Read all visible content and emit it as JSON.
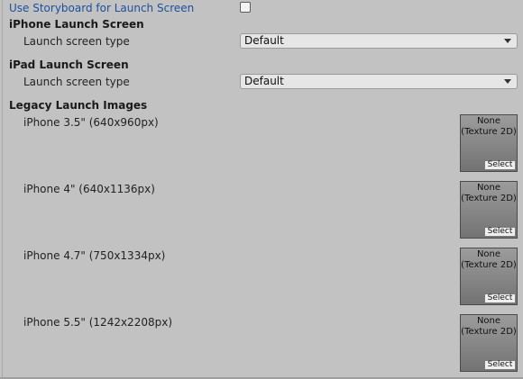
{
  "use_storyboard": {
    "label": "Use Storyboard for Launch Screen",
    "checked": false
  },
  "iphone_launch": {
    "heading": "iPhone Launch Screen",
    "type_label": "Launch screen type",
    "type_value": "Default"
  },
  "ipad_launch": {
    "heading": "iPad Launch Screen",
    "type_label": "Launch screen type",
    "type_value": "Default"
  },
  "legacy": {
    "heading": "Legacy Launch Images",
    "images": [
      {
        "label": "iPhone 3.5\" (640x960px)",
        "texture_line1": "None",
        "texture_line2": "(Texture 2D)",
        "select_label": "Select"
      },
      {
        "label": "iPhone 4\" (640x1136px)",
        "texture_line1": "None",
        "texture_line2": "(Texture 2D)",
        "select_label": "Select"
      },
      {
        "label": "iPhone 4.7\" (750x1334px)",
        "texture_line1": "None",
        "texture_line2": "(Texture 2D)",
        "select_label": "Select"
      },
      {
        "label": "iPhone 5.5\" (1242x2208px)",
        "texture_line1": "None",
        "texture_line2": "(Texture 2D)",
        "select_label": "Select"
      }
    ]
  },
  "icons": {
    "dropdown": "chevron-down-icon"
  },
  "colors": {
    "background": "#c2c2c2",
    "link_label": "#1e4f9c"
  }
}
